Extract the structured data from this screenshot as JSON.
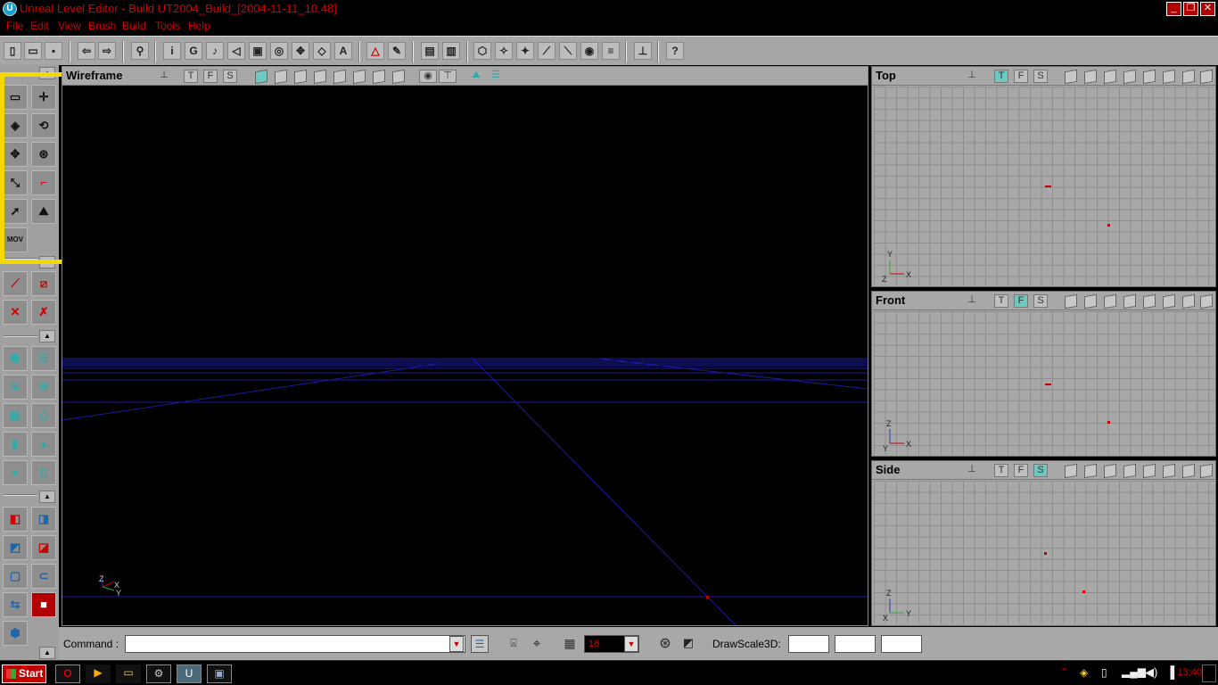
{
  "title_bar": {
    "app_icon": "unreal-icon",
    "title": "Unreal Level Editor - Build UT2004_Build_[2004-11-11_10.48]",
    "minimize": "_",
    "maximize": "❐",
    "close": "✕"
  },
  "menu": [
    "File",
    "Edit",
    "View",
    "Brush",
    "Build",
    "Tools",
    "Help"
  ],
  "toolbar": {
    "font_icon_label": "A",
    "g_icon_label": "G",
    "info_icon_label": "i"
  },
  "left_panel": {
    "mover_label": "MOV"
  },
  "viewport_perspective": {
    "title": "Wireframe",
    "mode_t": "T",
    "mode_f": "F",
    "mode_s": "S",
    "axis_z": "Z",
    "axis_x": "X",
    "axis_y": "Y"
  },
  "viewport_top": {
    "title": "Top",
    "mode_t": "T",
    "mode_f": "F",
    "mode_s": "S",
    "active_mode": "T",
    "axis_a": "Y",
    "axis_b": "X",
    "axis_c": "Z"
  },
  "viewport_front": {
    "title": "Front",
    "mode_t": "T",
    "mode_f": "F",
    "mode_s": "S",
    "active_mode": "F",
    "axis_a": "Z",
    "axis_b": "X",
    "axis_c": "Y"
  },
  "viewport_side": {
    "title": "Side",
    "mode_t": "T",
    "mode_f": "F",
    "mode_s": "S",
    "active_mode": "S",
    "axis_a": "Z",
    "axis_b": "Y",
    "axis_c": "X"
  },
  "command_bar": {
    "command_label": "Command :",
    "command_value": "",
    "grid_size": "16",
    "drawscale_label": "DrawScale3D:",
    "drawscale_x": "",
    "drawscale_y": "",
    "drawscale_z": ""
  },
  "taskbar": {
    "start_label": "Start",
    "clock": "13:40"
  },
  "colors": {
    "menu_text": "#d40000",
    "highlight_box": "#f5d800",
    "active_mode_button": "#6ec8c0",
    "perspective_grid": "#1a1aa0"
  }
}
